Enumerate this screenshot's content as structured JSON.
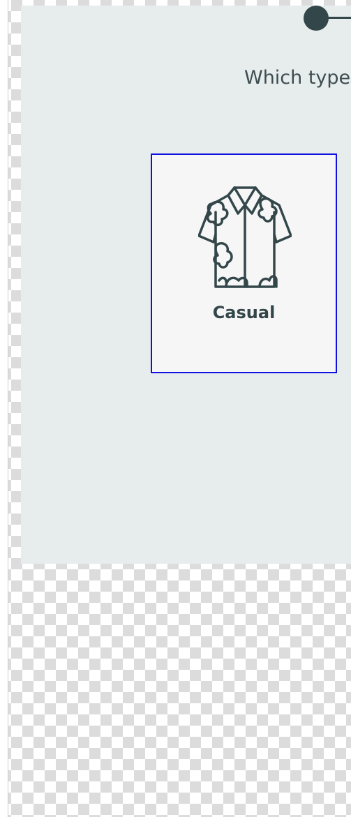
{
  "question": {
    "text": "Which type"
  },
  "options": [
    {
      "label": "Casual",
      "icon": "hawaiian-shirt-icon",
      "selected": true
    }
  ],
  "colors": {
    "panel_background": "#e7eced",
    "accent_dark": "#33474a",
    "card_background": "#f6f6f6",
    "selection_outline": "#1010e0"
  }
}
